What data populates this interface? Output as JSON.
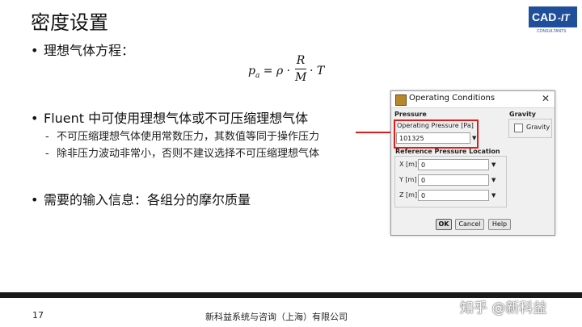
{
  "slide": {
    "title": "密度设置",
    "bullets": [
      {
        "text": "理想气体方程："
      },
      {
        "text": "Fluent 中可使用理想气体或不可压缩理想气体"
      },
      {
        "text": "需要的输入信息：各组分的摩尔质量"
      }
    ],
    "sub_bullets": [
      "不可压缩理想气体使用常数压力，其数值等同于操作压力",
      "除非压力波动非常小，否则不建议选择不可压缩理想气体"
    ],
    "formula": {
      "lhs": "p",
      "lhs_sub": "a",
      "eq": " = ρ ·",
      "num": "R",
      "den": "M",
      "rest": "· T"
    },
    "page_number": "17",
    "company": "新科益系统与咨询（上海）有限公司",
    "logo_text": "CAD",
    "logo_text2": "-IT",
    "logo_sub": "CONSULTANTS",
    "watermark": "知乎 @新科益"
  },
  "dialog": {
    "title": "Operating Conditions",
    "pressure_label": "Pressure",
    "operating_pressure_label": "Operating Pressure [Pa]",
    "operating_pressure_value": "101325",
    "reference_label": "Reference Pressure Location",
    "x_label": "X [m]",
    "x_value": "0",
    "y_label": "Y [m]",
    "y_value": "0",
    "z_label": "Z [m]",
    "z_value": "0",
    "gravity_label": "Gravity",
    "gravity_checkbox_label": "Gravity",
    "gravity_checked": false,
    "ok": "OK",
    "cancel": "Cancel",
    "help": "Help"
  },
  "colors": {
    "highlight": "#e01b1b",
    "logo_blue": "#1f4f9a",
    "footer": "#1a1a1a"
  }
}
